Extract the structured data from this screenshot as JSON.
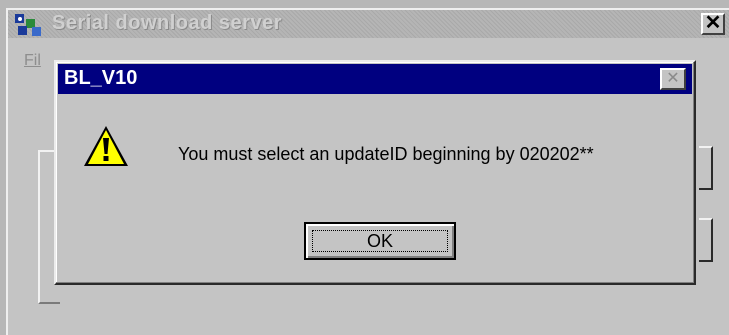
{
  "background_window": {
    "title": "Serial download server",
    "menu_file": "Fil",
    "close_glyph": "✕"
  },
  "dialog": {
    "title": "BL_V10",
    "close_glyph": "✕",
    "icon": "warning-icon",
    "message": "You must select an updateID beginning by 020202**",
    "ok_label": "OK"
  },
  "colors": {
    "title_active": "#000080",
    "face": "#c4c4c4",
    "warning_yellow": "#ffff00"
  }
}
